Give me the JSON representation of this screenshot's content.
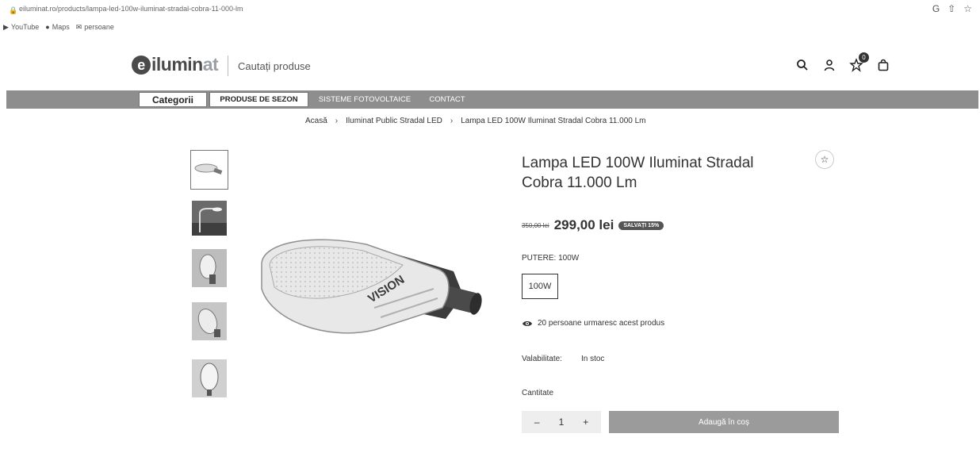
{
  "browser": {
    "url": "eiluminat.ro/products/lampa-led-100w-iluminat-stradal-cobra-11-000-lm",
    "bookmarks": [
      "YouTube",
      "Maps",
      "persoane"
    ]
  },
  "header": {
    "logo_text_dark": "ilumin",
    "logo_text_accent": "at",
    "search_placeholder": "Cautați produse",
    "cart_count": "0"
  },
  "nav": {
    "categories": "Categorii",
    "items": [
      "PRODUSE DE SEZON",
      "SISTEME FOTOVOLTAICE",
      "CONTACT"
    ]
  },
  "breadcrumb": {
    "items": [
      "Acasă",
      "Iluminat Public Stradal LED",
      "Lampa LED 100W Iluminat Stradal Cobra 11.000 Lm"
    ]
  },
  "product": {
    "title": "Lampa LED 100W Iluminat Stradal Cobra 11.000 Lm",
    "old_price": "350,00 lei",
    "price": "299,00 lei",
    "save_badge": "SALVAȚI 15%",
    "attribute_label": "PUTERE: 100W",
    "variant": "100W",
    "watchers": "20 persoane urmaresc acest produs",
    "availability_label": "Valabilitate:",
    "availability_value": "In stoc",
    "quantity_label": "Cantitate",
    "quantity": "1",
    "add_to_cart": "Adaugă în coș",
    "image_brand": "VISION"
  },
  "colors": {
    "nav_bg": "#8e8e8e",
    "button_bg": "#9b9b9b"
  }
}
